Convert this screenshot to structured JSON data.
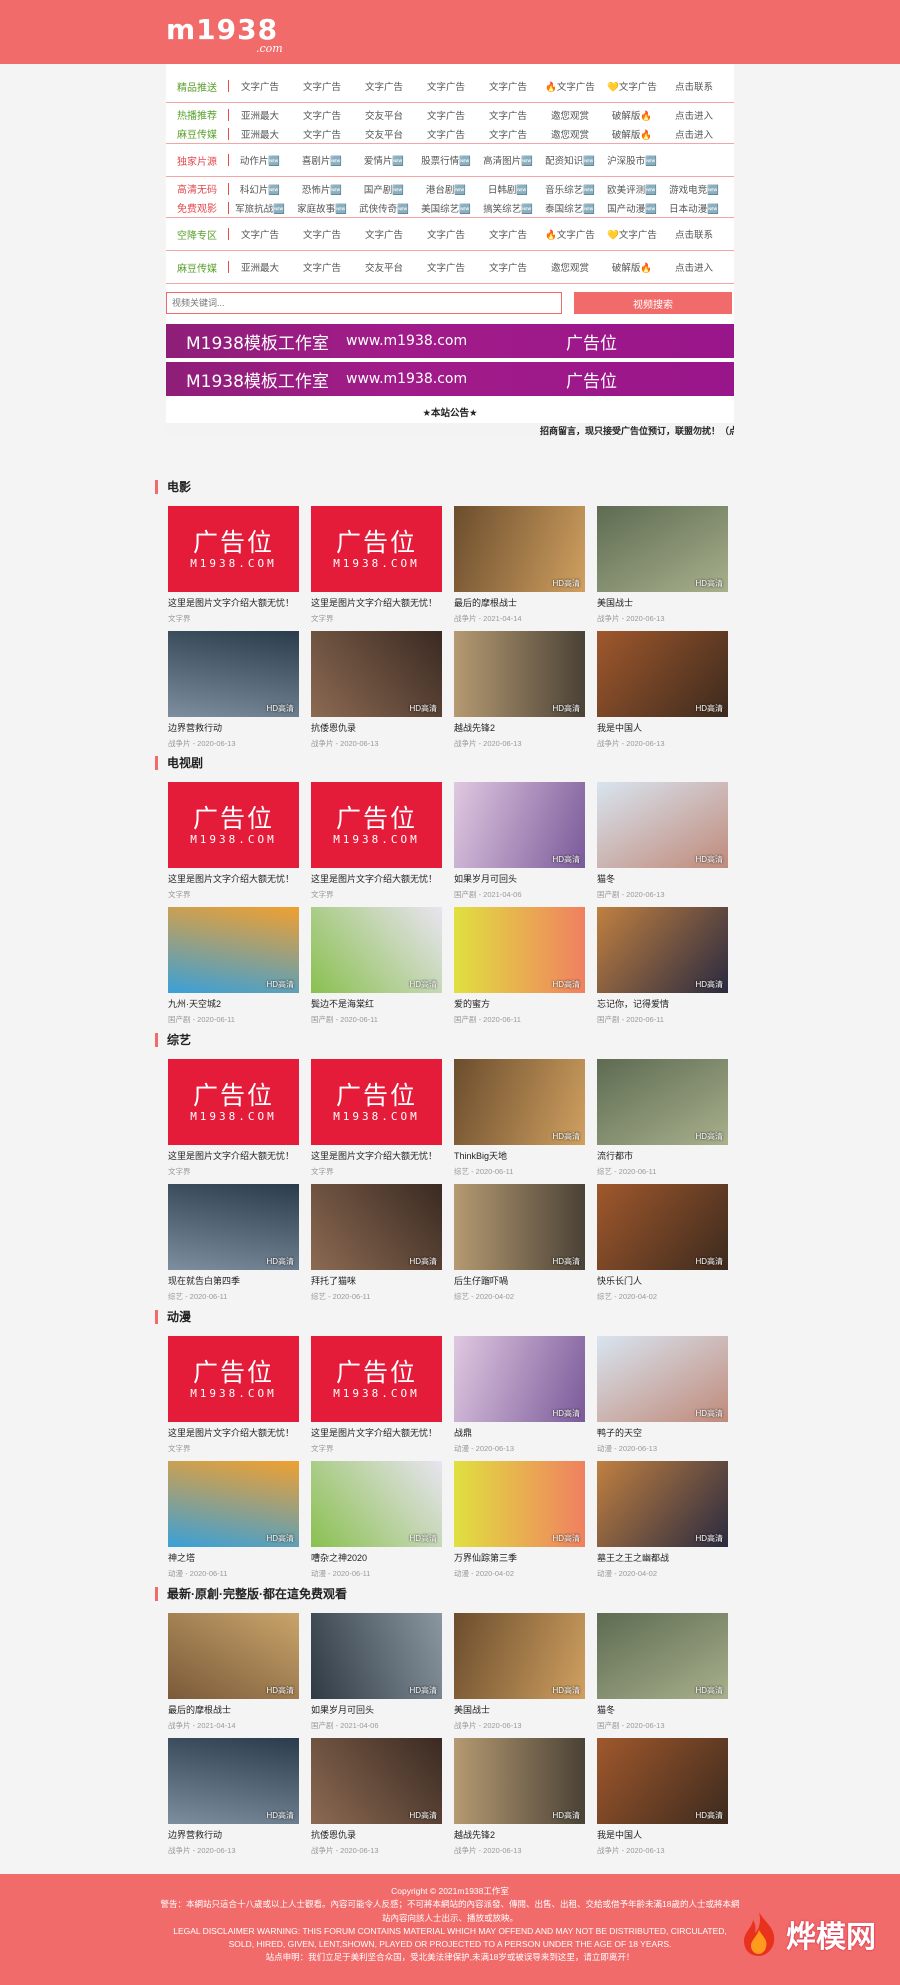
{
  "header": {
    "logo_main": "m1938",
    "logo_sub": ".com"
  },
  "nav": {
    "rows": [
      {
        "category": "精品推送",
        "cat_color": "green",
        "links": [
          "文字广告",
          "文字广告",
          "文字广告",
          "文字广告",
          "文字广告",
          "🔥文字广告",
          "💛文字广告",
          "点击联系"
        ]
      },
      {
        "double": true,
        "categories": [
          "热播推荐",
          "麻豆传媒"
        ],
        "cat_color": "green",
        "sub_rows": [
          [
            "亚洲最大",
            "文字广告",
            "交友平台",
            "文字广告",
            "文字广告",
            "邀您观赏",
            "破解版🔥",
            "点击进入"
          ],
          [
            "亚洲最大",
            "文字广告",
            "交友平台",
            "文字广告",
            "文字广告",
            "邀您观赏",
            "破解版🔥",
            "点击进入"
          ]
        ]
      },
      {
        "category": "独家片源",
        "cat_color": "red",
        "links": [
          "动作片🆕",
          "喜剧片🆕",
          "爱情片🆕",
          "股票行情🆕",
          "高清图片🆕",
          "配资知识🆕",
          "沪深股市🆕"
        ]
      },
      {
        "double": true,
        "categories": [
          "高清无码",
          "免费观影"
        ],
        "cat_color": "red",
        "sub_rows": [
          [
            "科幻片🆕",
            "恐怖片🆕",
            "国产剧🆕",
            "港台剧🆕",
            "日韩剧🆕",
            "音乐综艺🆕",
            "欧美评测🆕",
            "游戏电竞🆕"
          ],
          [
            "军旅抗战🆕",
            "家庭故事🆕",
            "武侠传奇🆕",
            "美国综艺🆕",
            "搞笑综艺🆕",
            "泰国综艺🆕",
            "国产动漫🆕",
            "日本动漫🆕"
          ]
        ]
      },
      {
        "category": "空降专区",
        "cat_color": "green",
        "links": [
          "文字广告",
          "文字广告",
          "文字广告",
          "文字广告",
          "文字广告",
          "🔥文字广告",
          "💛文字广告",
          "点击联系"
        ]
      },
      {
        "category": "麻豆传媒",
        "cat_color": "green",
        "links": [
          "亚洲最大",
          "文字广告",
          "交友平台",
          "文字广告",
          "文字广告",
          "邀您观赏",
          "破解版🔥",
          "点击进入"
        ]
      }
    ]
  },
  "search": {
    "placeholder": "视频关键词...",
    "button": "视频搜索"
  },
  "banners": [
    {
      "name": "M1938模板工作室",
      "url": "www.m1938.com",
      "label": "广告位"
    },
    {
      "name": "M1938模板工作室",
      "url": "www.m1938.com",
      "label": "广告位"
    }
  ],
  "notice": {
    "title": "★本站公告★",
    "text": "招商留言，现只接受广告位预订，联盟勿扰！（点击"
  },
  "ad": {
    "big": "广告位",
    "small": "M1938.COM",
    "title": "这里是图片文字介绍大额无忧！",
    "meta": "文字界"
  },
  "badge": "HD高清",
  "sections": [
    {
      "title": "电影",
      "items": [
        {
          "ad": true
        },
        {
          "ad": true
        },
        {
          "title": "最后的摩根战士",
          "meta": "战争片 - 2021-04-14"
        },
        {
          "title": "美国战士",
          "meta": "战争片 - 2020-06-13"
        },
        {
          "title": "边界营救行动",
          "meta": "战争片 - 2020-06-13"
        },
        {
          "title": "抗倭恩仇录",
          "meta": "战争片 - 2020-06-13"
        },
        {
          "title": "越战先锋2",
          "meta": "战争片 - 2020-06-13"
        },
        {
          "title": "我是中国人",
          "meta": "战争片 - 2020-06-13"
        }
      ]
    },
    {
      "title": "电视剧",
      "items": [
        {
          "ad": true
        },
        {
          "ad": true
        },
        {
          "title": "如果岁月可回头",
          "meta": "国产剧 - 2021-04-06"
        },
        {
          "title": "猫冬",
          "meta": "国产剧 - 2020-06-13"
        },
        {
          "title": "九州·天空城2",
          "meta": "国产剧 - 2020-06-11"
        },
        {
          "title": "鬓边不是海棠红",
          "meta": "国产剧 - 2020-06-11"
        },
        {
          "title": "爱的蜜方",
          "meta": "国产剧 - 2020-06-11"
        },
        {
          "title": "忘记你，记得爱情",
          "meta": "国产剧 - 2020-06-11"
        }
      ]
    },
    {
      "title": "综艺",
      "items": [
        {
          "ad": true
        },
        {
          "ad": true
        },
        {
          "title": "ThinkBig天地",
          "meta": "综艺 - 2020-06-11"
        },
        {
          "title": "流行都市",
          "meta": "综艺 - 2020-06-11"
        },
        {
          "title": "现在就告白第四季",
          "meta": "综艺 - 2020-06-11"
        },
        {
          "title": "拜托了猫咪",
          "meta": "综艺 - 2020-06-11"
        },
        {
          "title": "后生仔蹓吓喎",
          "meta": "综艺 - 2020-04-02"
        },
        {
          "title": "快乐长门人",
          "meta": "综艺 - 2020-04-02"
        }
      ]
    },
    {
      "title": "动漫",
      "items": [
        {
          "ad": true
        },
        {
          "ad": true
        },
        {
          "title": "战鼎",
          "meta": "动漫 - 2020-06-13"
        },
        {
          "title": "鸭子的天空",
          "meta": "动漫 - 2020-06-13"
        },
        {
          "title": "神之塔",
          "meta": "动漫 - 2020-06-11"
        },
        {
          "title": "嘈杂之神2020",
          "meta": "动漫 - 2020-06-11"
        },
        {
          "title": "万界仙踪第三季",
          "meta": "动漫 - 2020-04-02"
        },
        {
          "title": "墓王之王之幽都战",
          "meta": "动漫 - 2020-04-02"
        }
      ]
    },
    {
      "title": "最新·原創·完整版·都在這免费观看",
      "items": [
        {
          "title": "最后的摩根战士",
          "meta": "战争片 - 2021-04-14"
        },
        {
          "title": "如果岁月可回头",
          "meta": "国产剧 - 2021-04-06"
        },
        {
          "title": "美国战士",
          "meta": "战争片 - 2020-06-13"
        },
        {
          "title": "猫冬",
          "meta": "国产剧 - 2020-06-13"
        },
        {
          "title": "边界营救行动",
          "meta": "战争片 - 2020-06-13"
        },
        {
          "title": "抗倭恩仇录",
          "meta": "战争片 - 2020-06-13"
        },
        {
          "title": "越战先锋2",
          "meta": "战争片 - 2020-06-13"
        },
        {
          "title": "我是中国人",
          "meta": "战争片 - 2020-06-13"
        }
      ]
    }
  ],
  "footer": {
    "lines": [
      "Copyright © 2021m1938工作室",
      "警告：本網站只這合十八歲或以上人士觀看。內容可能令人反感；不可將本網站的內容派發、傳閱、出售、出租、交給或借予年齡未滿18歲的人士或將本網",
      "站內容向該人士出示、播放或放映。",
      "LEGAL DISCLAIMER WARNING: THIS FORUM CONTAINS MATERIAL WHICH MAY OFFEND AND MAY NOT BE DISTRIBUTED, CIRCULATED,",
      "SOLD, HIRED, GIVEN, LENT,SHOWN, PLAYED OR PROJECTED TO A PERSON UNDER THE AGE OF 18 YEARS.",
      "站点申明：我们立足于美利坚合众国，受北美法律保护,未满18岁或被误导来到这里，请立即离开！"
    ],
    "watermark": "烨模网"
  },
  "colors": {
    "primary": "#f26b6b",
    "banner": "#a21b8a",
    "ad": "#e51b3a",
    "green": "#5aa02c",
    "red": "#e0484d"
  }
}
